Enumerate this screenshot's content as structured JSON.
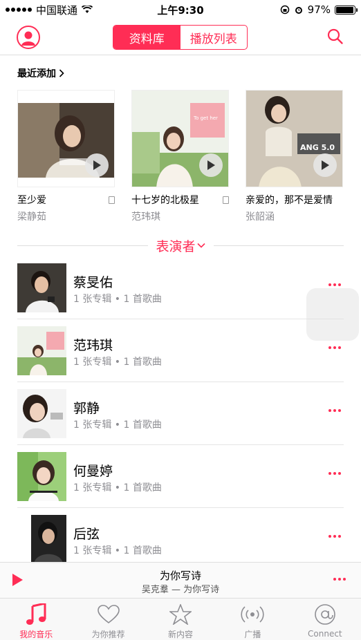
{
  "status_bar": {
    "carrier": "中国联通",
    "time": "上午9:30",
    "battery": "97%",
    "battery_level": 0.97
  },
  "nav": {
    "segments": [
      "资料库",
      "播放列表"
    ],
    "active_segment": 0
  },
  "recently_added": {
    "title": "最近添加",
    "albums": [
      {
        "title": "至少爱",
        "artist": "梁静茹"
      },
      {
        "title": "十七岁的北极星",
        "artist": "范玮琪",
        "cover_text": "To get her"
      },
      {
        "title": "亲爱的，那不是爱情",
        "artist": "张韶涵",
        "cover_text": "ANG 5.0"
      }
    ]
  },
  "artists": {
    "header": "表演者",
    "items": [
      {
        "name": "蔡旻佑",
        "meta": "1 张专辑 • 1 首歌曲"
      },
      {
        "name": "范玮琪",
        "meta": "1 张专辑 • 1 首歌曲"
      },
      {
        "name": "郭静",
        "meta": "1 张专辑 • 1 首歌曲"
      },
      {
        "name": "何曼婷",
        "meta": "1 张专辑 • 1 首歌曲"
      },
      {
        "name": "后弦",
        "meta": "1 张专辑 • 1 首歌曲"
      }
    ]
  },
  "mini_player": {
    "song": "为你写诗",
    "subtitle": "吴克羣 — 为你写诗"
  },
  "tabs": [
    {
      "label": "我的音乐",
      "icon": "music-note-icon",
      "active": true
    },
    {
      "label": "为你推荐",
      "icon": "heart-icon",
      "active": false
    },
    {
      "label": "新内容",
      "icon": "star-icon",
      "active": false
    },
    {
      "label": "广播",
      "icon": "radio-icon",
      "active": false
    },
    {
      "label": "Connect",
      "icon": "at-icon",
      "active": false
    }
  ],
  "colors": {
    "accent": "#ff2d55",
    "secondary_text": "#8e8e93"
  }
}
